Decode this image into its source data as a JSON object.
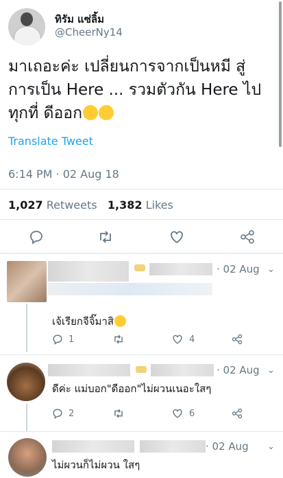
{
  "tweet": {
    "display_name": "ทิรัม แซ่ลิ้ม",
    "handle": "@CheerNy14",
    "text": "มาเถอะค่ะ เปลี่ยนการจากเป็นหมี สู่การเป็น Here ... รวมตัวกัน Here ไปทุกที่ ดีออก",
    "translate_label": "Translate Tweet",
    "timestamp": "6:14 PM · 02 Aug 18",
    "retweets_count": "1,027",
    "retweets_label": "Retweets",
    "likes_count": "1,382",
    "likes_label": "Likes"
  },
  "replies": [
    {
      "date": "· 02 Aug",
      "text": "เจ้เรียกจีจิ๊มาสิ",
      "reply_count": "1",
      "retweet_count": "",
      "like_count": "4"
    },
    {
      "date": "· 02 Aug",
      "text": "ดีค่ะ แม่บอก\"ดีออก\"ไม่ผวนเนอะใสๆ",
      "reply_count": "2",
      "retweet_count": "",
      "like_count": "6"
    },
    {
      "date": "· 02 Aug",
      "text": "ไม่ผวนก็ไม่ผวน ใสๆ"
    }
  ],
  "icons": [
    "reply-icon",
    "retweet-icon",
    "like-icon",
    "share-icon",
    "chevron-down-icon"
  ],
  "colors": {
    "link": "#1da1f2",
    "muted": "#657786",
    "text": "#14171a"
  }
}
